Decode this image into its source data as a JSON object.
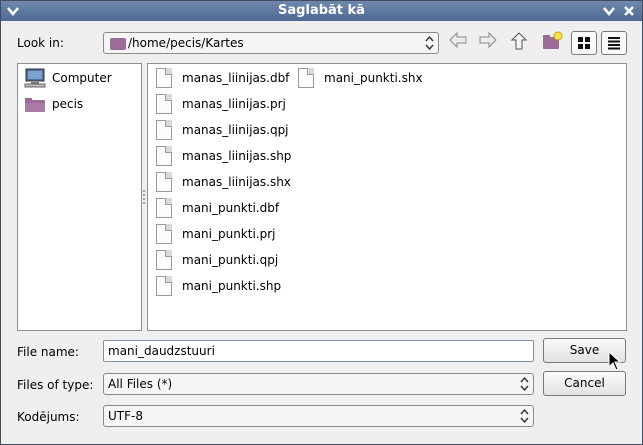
{
  "window": {
    "title": "Saglabāt kā"
  },
  "titlebar": {
    "menu_icon": "chevron-down-icon",
    "minimize_icon": "chevron-down-icon",
    "close_icon": "close-icon"
  },
  "lookin": {
    "label": "Look in:",
    "path": "/home/pecis/Kartes"
  },
  "toolbar": {
    "back_icon": "arrow-left-icon",
    "forward_icon": "arrow-right-icon",
    "up_icon": "arrow-up-icon",
    "new_folder_icon": "new-folder-icon",
    "icon_view_icon": "grid-view-icon",
    "list_view_icon": "list-view-icon"
  },
  "places": [
    {
      "label": "Computer",
      "icon": "computer-icon"
    },
    {
      "label": "pecis",
      "icon": "home-folder-icon"
    }
  ],
  "files": {
    "column1": [
      "manas_liinijas.dbf",
      "manas_liinijas.prj",
      "manas_liinijas.qpj",
      "manas_liinijas.shp",
      "manas_liinijas.shx",
      "mani_punkti.dbf",
      "mani_punkti.prj",
      "mani_punkti.qpj",
      "mani_punkti.shp"
    ],
    "column2": [
      "mani_punkti.shx"
    ]
  },
  "filename": {
    "label": "File name:",
    "value": "mani_daudzstuuri"
  },
  "filetype": {
    "label": "Files of type:",
    "value": "All Files (*)"
  },
  "encoding": {
    "label": "Kodējums:",
    "value": "UTF-8"
  },
  "buttons": {
    "save": "Save",
    "cancel": "Cancel"
  },
  "colors": {
    "title_bar": "#5b769d",
    "window_bg": "#efefef",
    "folder": "#9a6c96"
  }
}
